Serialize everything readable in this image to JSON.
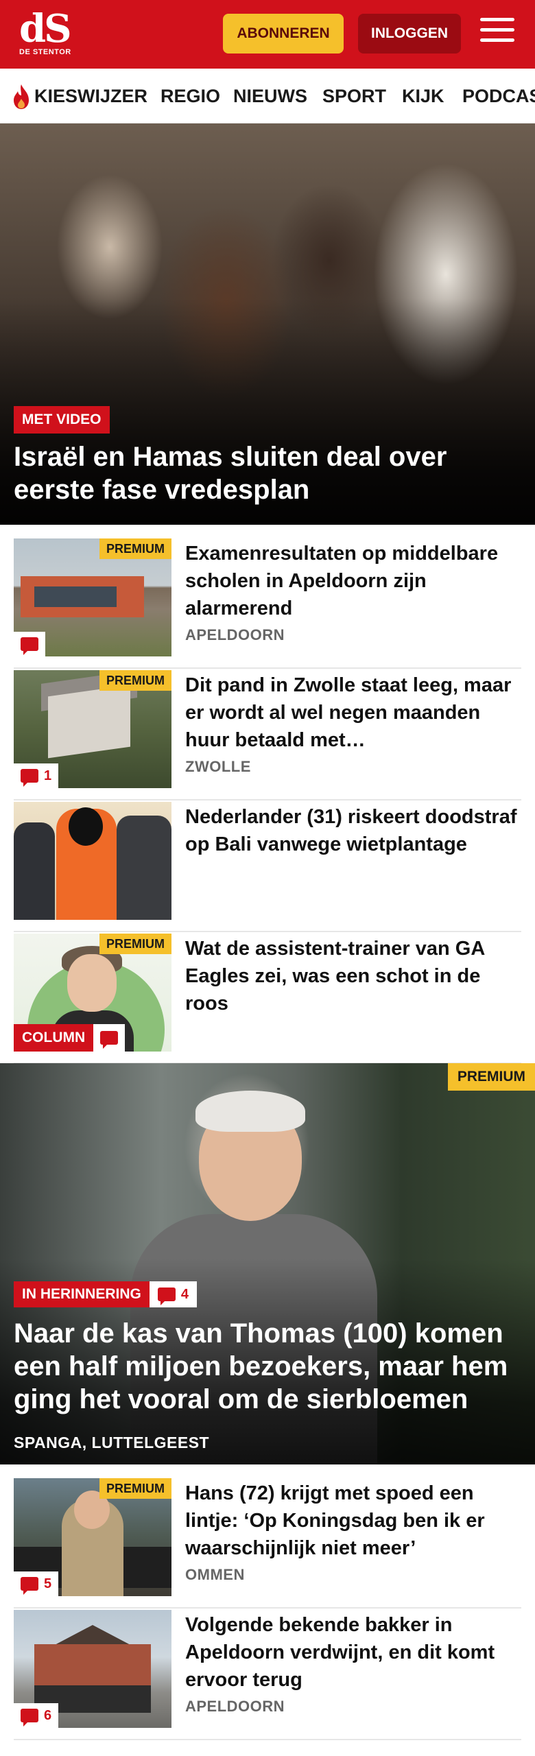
{
  "header": {
    "logo_mark": "dS",
    "logo_sub": "DE STENTOR",
    "subscribe_label": "ABONNEREN",
    "login_label": "INLOGGEN",
    "menu_icon": "hamburger-icon"
  },
  "nav": {
    "items": [
      {
        "label": "KIESWIJZER",
        "icon": "flame-icon"
      },
      {
        "label": "REGIO"
      },
      {
        "label": "NIEUWS"
      },
      {
        "label": "SPORT"
      },
      {
        "label": "KIJK"
      },
      {
        "label": "PODCAS"
      }
    ]
  },
  "hero": {
    "label": "MET VIDEO",
    "title": "Israël en Hamas sluiten deal over eerste fase vredesplan"
  },
  "articles": [
    {
      "premium": "PREMIUM",
      "title": "Examenresultaten op middelbare scholen in Apeldoorn zijn alarmerend",
      "meta": "APELDOORN",
      "comments": ""
    },
    {
      "premium": "PREMIUM",
      "title": "Dit pand in Zwolle staat leeg, maar er wordt al wel negen maanden huur betaald met…",
      "meta": "ZWOLLE",
      "comments": "1"
    },
    {
      "premium": "",
      "title": "Nederlander (31) riskeert doodstraf op Bali vanwege wietplantage",
      "meta": "",
      "comments": ""
    },
    {
      "premium": "PREMIUM",
      "title": "Wat de assistent-trainer van GA Eagles zei, was een schot in de roos",
      "meta": "",
      "tag": "COLUMN"
    }
  ],
  "feature": {
    "premium": "PREMIUM",
    "tag": "IN HERINNERING",
    "comments": "4",
    "title": "Naar de kas van Thomas (100) komen een half miljoen bezoekers, maar hem ging het vooral om de sierbloemen",
    "meta": "SPANGA, LUTTELGEEST"
  },
  "articles2": [
    {
      "premium": "PREMIUM",
      "title": "Hans (72) krijgt met spoed een lintje: ‘Op Koningsdag ben ik er waarschijnlijk niet meer’",
      "meta": "OMMEN",
      "comments": "5"
    },
    {
      "premium": "",
      "title": "Volgende bekende bakker in Apeldoorn verdwijnt, en dit komt ervoor terug",
      "meta": "APELDOORN",
      "comments": "6"
    }
  ],
  "colors": {
    "brand_red": "#d0111b",
    "premium_yellow": "#f5c02b",
    "login_dark_red": "#9b0b12"
  }
}
